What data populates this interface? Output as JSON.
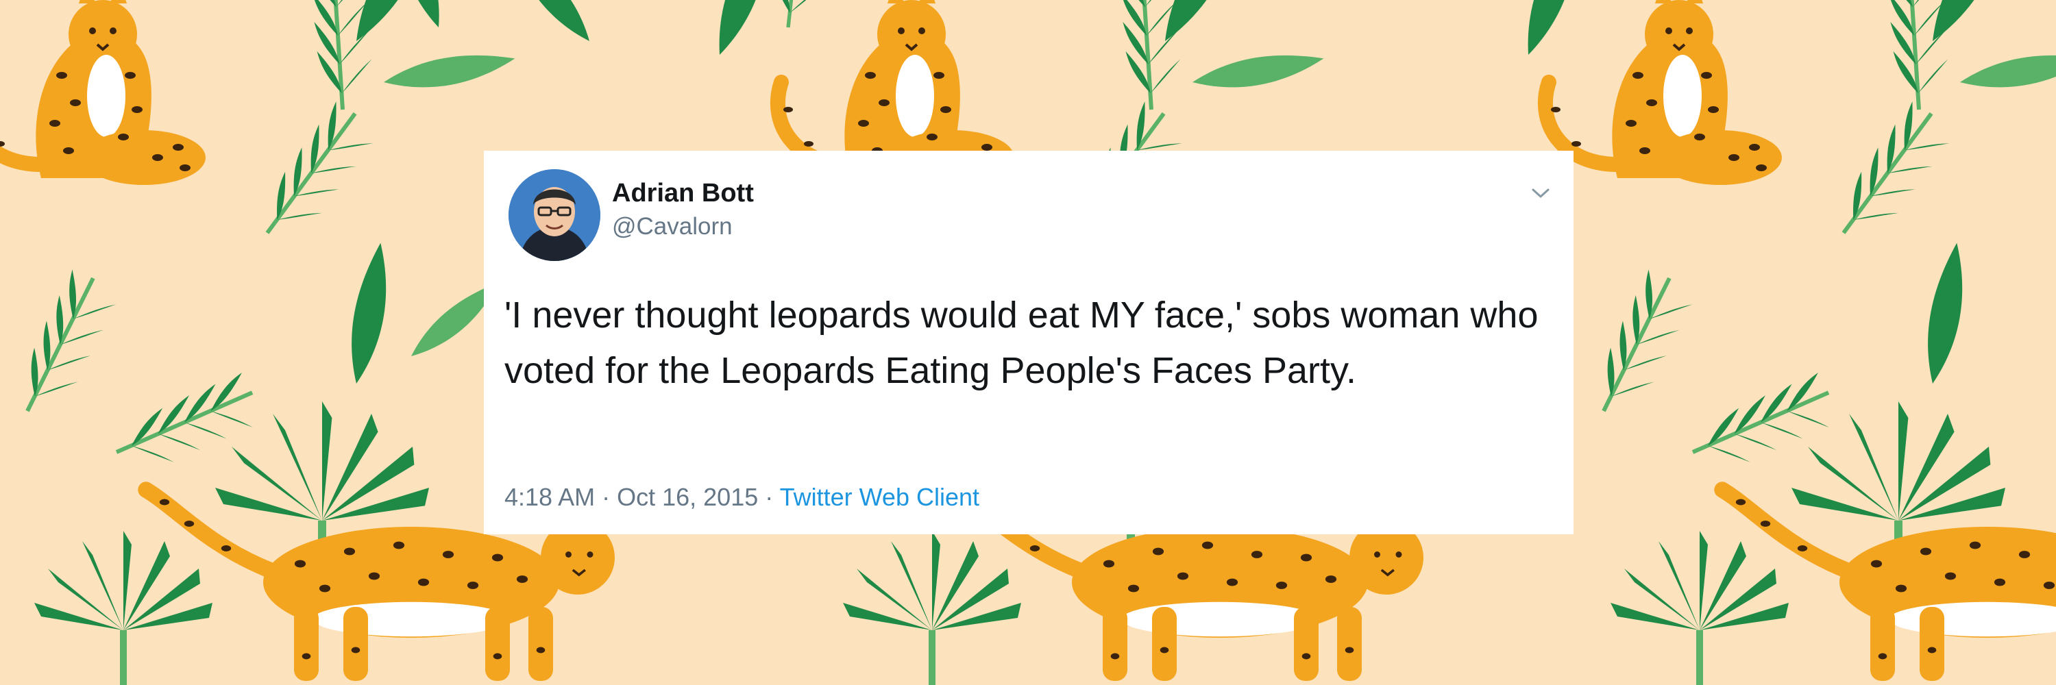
{
  "tweet": {
    "author_name": "Adrian Bott",
    "author_handle": "@Cavalorn",
    "text": "'I never thought leopards would eat MY face,' sobs woman who voted for the Leopards Eating People's Faces Party.",
    "time": "4:18 AM",
    "separator": " · ",
    "date": "Oct 16, 2015",
    "source": "Twitter Web Client"
  },
  "icons": {
    "menu": "chevron-down-icon",
    "avatar": "avatar-illustration"
  },
  "colors": {
    "background": "#fde2be",
    "leopard_fur": "#f4a51f",
    "leopard_spots": "#3a2410",
    "leaf_dark": "#1f8a46",
    "leaf_light": "#59b267",
    "card": "#ffffff",
    "text": "#14171a",
    "muted": "#657786",
    "link": "#1b95e0"
  }
}
